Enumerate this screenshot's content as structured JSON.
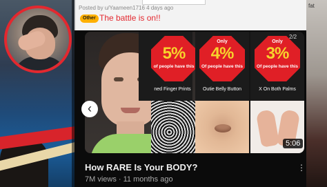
{
  "post": {
    "posted_by": "Posted by u/Yaameen1716 4 days ago",
    "flair": "Other",
    "title": "The battle is on!!"
  },
  "thumbnail": {
    "page_indicator": "2/2",
    "cards": [
      {
        "only": "",
        "percent": "5%",
        "sub": "of people have this",
        "caption": "ned Finger Prints"
      },
      {
        "only": "Only",
        "percent": "4%",
        "sub": "Of people have this",
        "caption": "Outie Belly Button"
      },
      {
        "only": "Only",
        "percent": "3%",
        "sub": "Of people have this",
        "caption": "X On Both Palms"
      }
    ],
    "duration": "5:06"
  },
  "video": {
    "title": "How RARE Is Your BODY?",
    "meta": "7M views · 11 months ago"
  },
  "side_tag": "fat",
  "icons": {
    "prev": "chevron-left-icon",
    "more": "more-vertical-icon",
    "arrow": "red-arrow-icon"
  },
  "colors": {
    "accent_red": "#e01f26",
    "flair_bg": "#ffb000",
    "percent_yellow": "#f7d32c",
    "title_red": "#e3282f"
  }
}
